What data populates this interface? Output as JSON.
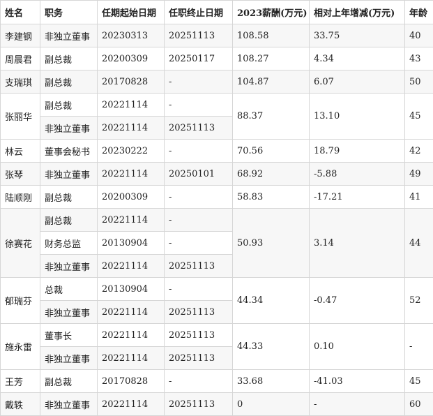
{
  "table": {
    "headers": [
      "姓名",
      "职务",
      "任期起始日期",
      "任职终止日期",
      "2023薪酬(万元)",
      "相对上年增减(万元)",
      "年龄"
    ],
    "people": [
      {
        "name": "李建钢",
        "salary": "108.58",
        "change": "33.75",
        "age": "40",
        "positions": [
          {
            "title": "非独立董事",
            "start": "20230313",
            "end": "20251113"
          }
        ]
      },
      {
        "name": "周晨君",
        "salary": "108.27",
        "change": "4.34",
        "age": "43",
        "positions": [
          {
            "title": "副总裁",
            "start": "20200309",
            "end": "20250117"
          }
        ]
      },
      {
        "name": "支瑞琪",
        "salary": "104.87",
        "change": "6.07",
        "age": "50",
        "positions": [
          {
            "title": "副总裁",
            "start": "20170828",
            "end": "-"
          }
        ]
      },
      {
        "name": "张丽华",
        "salary": "88.37",
        "change": "13.10",
        "age": "45",
        "positions": [
          {
            "title": "副总裁",
            "start": "20221114",
            "end": "-"
          },
          {
            "title": "非独立董事",
            "start": "20221114",
            "end": "20251113"
          }
        ]
      },
      {
        "name": "林云",
        "salary": "70.56",
        "change": "18.79",
        "age": "42",
        "positions": [
          {
            "title": "董事会秘书",
            "start": "20230222",
            "end": "-"
          }
        ]
      },
      {
        "name": "张琴",
        "salary": "68.92",
        "change": "-5.88",
        "age": "49",
        "positions": [
          {
            "title": "非独立董事",
            "start": "20221114",
            "end": "20250101"
          }
        ]
      },
      {
        "name": "陆顺刚",
        "salary": "58.83",
        "change": "-17.21",
        "age": "41",
        "positions": [
          {
            "title": "副总裁",
            "start": "20200309",
            "end": "-"
          }
        ]
      },
      {
        "name": "徐赛花",
        "salary": "50.93",
        "change": "3.14",
        "age": "44",
        "positions": [
          {
            "title": "副总裁",
            "start": "20221114",
            "end": "-"
          },
          {
            "title": "财务总监",
            "start": "20130904",
            "end": "-"
          },
          {
            "title": "非独立董事",
            "start": "20221114",
            "end": "20251113"
          }
        ]
      },
      {
        "name": "郁瑞芬",
        "salary": "44.34",
        "change": "-0.47",
        "age": "52",
        "positions": [
          {
            "title": "总裁",
            "start": "20130904",
            "end": "-"
          },
          {
            "title": "非独立董事",
            "start": "20221114",
            "end": "20251113"
          }
        ]
      },
      {
        "name": "施永雷",
        "salary": "44.33",
        "change": "0.10",
        "age": "-",
        "positions": [
          {
            "title": "董事长",
            "start": "20221114",
            "end": "20251113"
          },
          {
            "title": "非独立董事",
            "start": "20221114",
            "end": "20251113"
          }
        ]
      },
      {
        "name": "王芳",
        "salary": "33.68",
        "change": "-41.03",
        "age": "45",
        "positions": [
          {
            "title": "副总裁",
            "start": "20170828",
            "end": "-"
          }
        ]
      },
      {
        "name": "戴轶",
        "salary": "0",
        "change": "-",
        "age": "60",
        "positions": [
          {
            "title": "非独立董事",
            "start": "20221114",
            "end": "20251113"
          }
        ]
      }
    ]
  }
}
